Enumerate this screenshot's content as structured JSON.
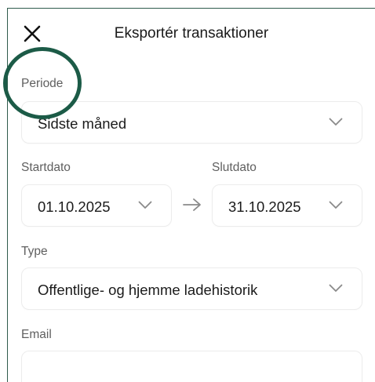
{
  "header": {
    "title": "Eksportér transaktioner",
    "close_icon": "close-icon"
  },
  "period": {
    "label": "Periode",
    "value": "Sidste måned"
  },
  "start": {
    "label": "Startdato",
    "value": "01.10.2025"
  },
  "end": {
    "label": "Slutdato",
    "value": "31.10.2025"
  },
  "type": {
    "label": "Type",
    "value": "Offentlige- og hjemme ladehistorik"
  },
  "email": {
    "label": "Email",
    "value": ""
  },
  "colors": {
    "frame": "#2f5b4c",
    "annotation_circle": "#1c5b47",
    "text": "#1b1b1b",
    "label": "#5f5f5f",
    "field_border": "#ececec"
  }
}
